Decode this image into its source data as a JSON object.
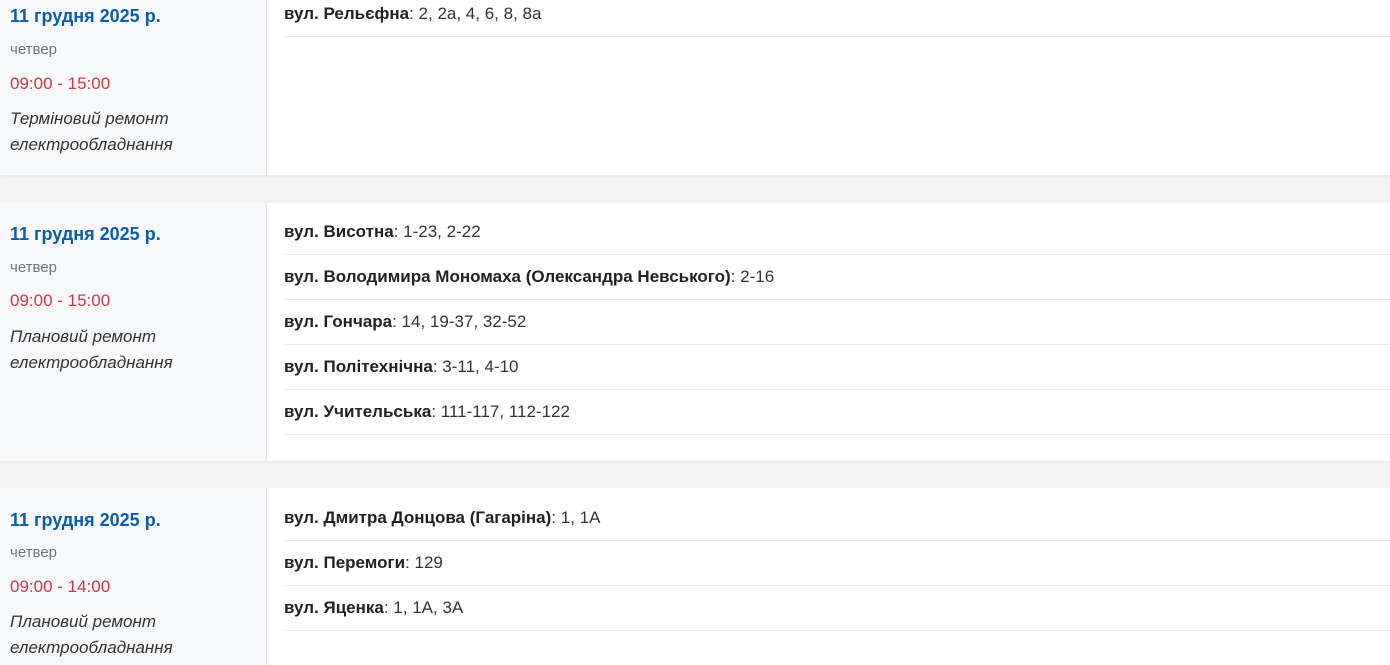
{
  "outages": [
    {
      "date": "11 грудня 2025 р.",
      "weekday": "четвер",
      "time": "09:00 - 15:00",
      "reason": "Терміновий ремонт електрообладнання",
      "addresses": [
        {
          "street": "вул. Рельєфна",
          "houses": ": 2, 2а, 4, 6, 8, 8а"
        }
      ]
    },
    {
      "date": "11 грудня 2025 р.",
      "weekday": "четвер",
      "time": "09:00 - 15:00",
      "reason": "Плановий ремонт електрообладнання",
      "addresses": [
        {
          "street": "вул. Висотна",
          "houses": ": 1-23, 2-22"
        },
        {
          "street": "вул. Володимира Мономаха (Олександра Невського)",
          "houses": ": 2-16"
        },
        {
          "street": "вул. Гончара",
          "houses": ": 14, 19-37, 32-52"
        },
        {
          "street": "вул. Політехнічна",
          "houses": ": 3-11, 4-10"
        },
        {
          "street": "вул. Учительська",
          "houses": ": 111-117, 112-122"
        }
      ]
    },
    {
      "date": "11 грудня 2025 р.",
      "weekday": "четвер",
      "time": "09:00 - 14:00",
      "reason": "Плановий ремонт електрообладнання",
      "addresses": [
        {
          "street": "вул. Дмитра Донцова (Гагаріна)",
          "houses": ": 1, 1А"
        },
        {
          "street": "вул. Перемоги",
          "houses": ": 129"
        },
        {
          "street": "вул. Яценка",
          "houses": ": 1, 1А, 3А"
        }
      ]
    }
  ],
  "colors": {
    "date": "#0b5cab",
    "time": "#d0343f",
    "page_background": "#f3f3f3"
  }
}
